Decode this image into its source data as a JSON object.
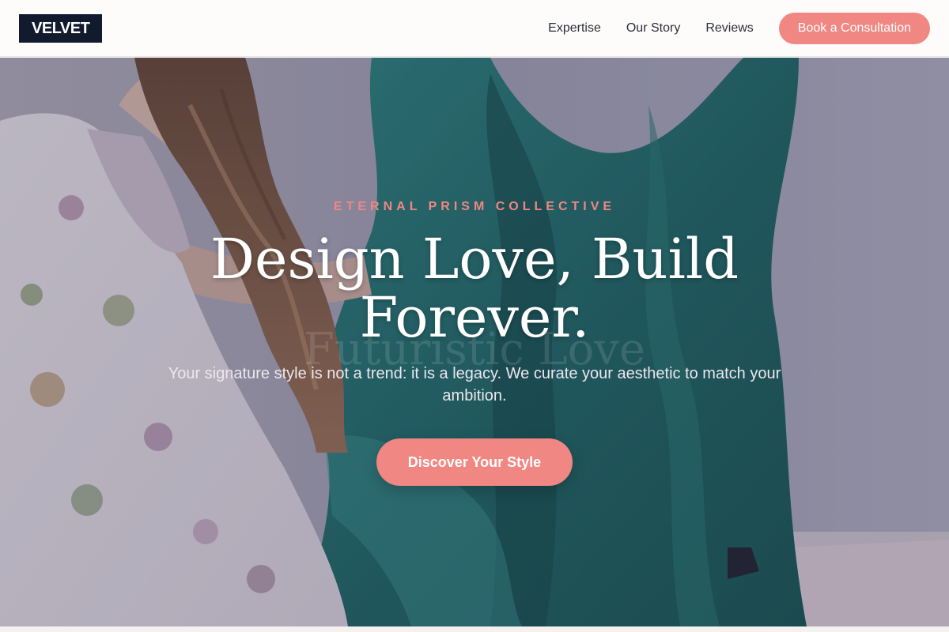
{
  "header": {
    "logo": "VELVET",
    "nav": [
      "Expertise",
      "Our Story",
      "Reviews"
    ],
    "cta": "Book a Consultation"
  },
  "hero": {
    "eyebrow": "ETERNAL PRISM COLLECTIVE",
    "headline": "Design Love, Build Forever.",
    "watermark": "Futuristic Love",
    "subtitle": "Your signature style is not a trend: it is a legacy. We curate your aesthetic to match your ambition.",
    "cta": "Discover Your Style"
  },
  "colors": {
    "accent": "#f08782",
    "brand_dark": "#121a2e",
    "fabric_teal": "#1e6b68"
  },
  "icons": {
    "hero_image": "woman-with-teal-fabric-photo"
  }
}
